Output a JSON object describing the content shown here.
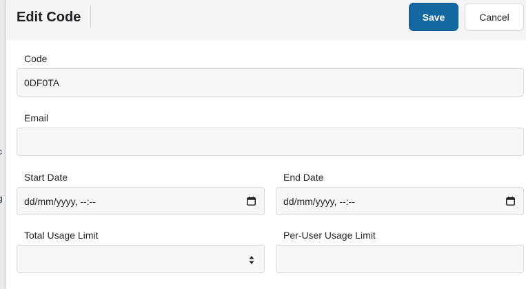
{
  "header": {
    "title": "Edit Code",
    "save_label": "Save",
    "cancel_label": "Cancel"
  },
  "backdrop": {
    "fragment_1": "c",
    "fragment_2": "g"
  },
  "form": {
    "code": {
      "label": "Code",
      "value": "0DF0TA"
    },
    "email": {
      "label": "Email",
      "value": ""
    },
    "start_date": {
      "label": "Start Date",
      "placeholder": "dd/mm/yyyy, --:--",
      "icon": "calendar-icon"
    },
    "end_date": {
      "label": "End Date",
      "placeholder": "dd/mm/yyyy, --:--",
      "icon": "calendar-icon"
    },
    "total_usage_limit": {
      "label": "Total Usage Limit",
      "value": "",
      "icon": "spinner-arrows-icon"
    },
    "per_user_usage_limit": {
      "label": "Per-User Usage Limit",
      "value": ""
    }
  },
  "colors": {
    "primary": "#1569a3",
    "header_bg": "#f3f4f5",
    "field_bg": "#f6f7f8",
    "field_border": "#d5d8db"
  }
}
